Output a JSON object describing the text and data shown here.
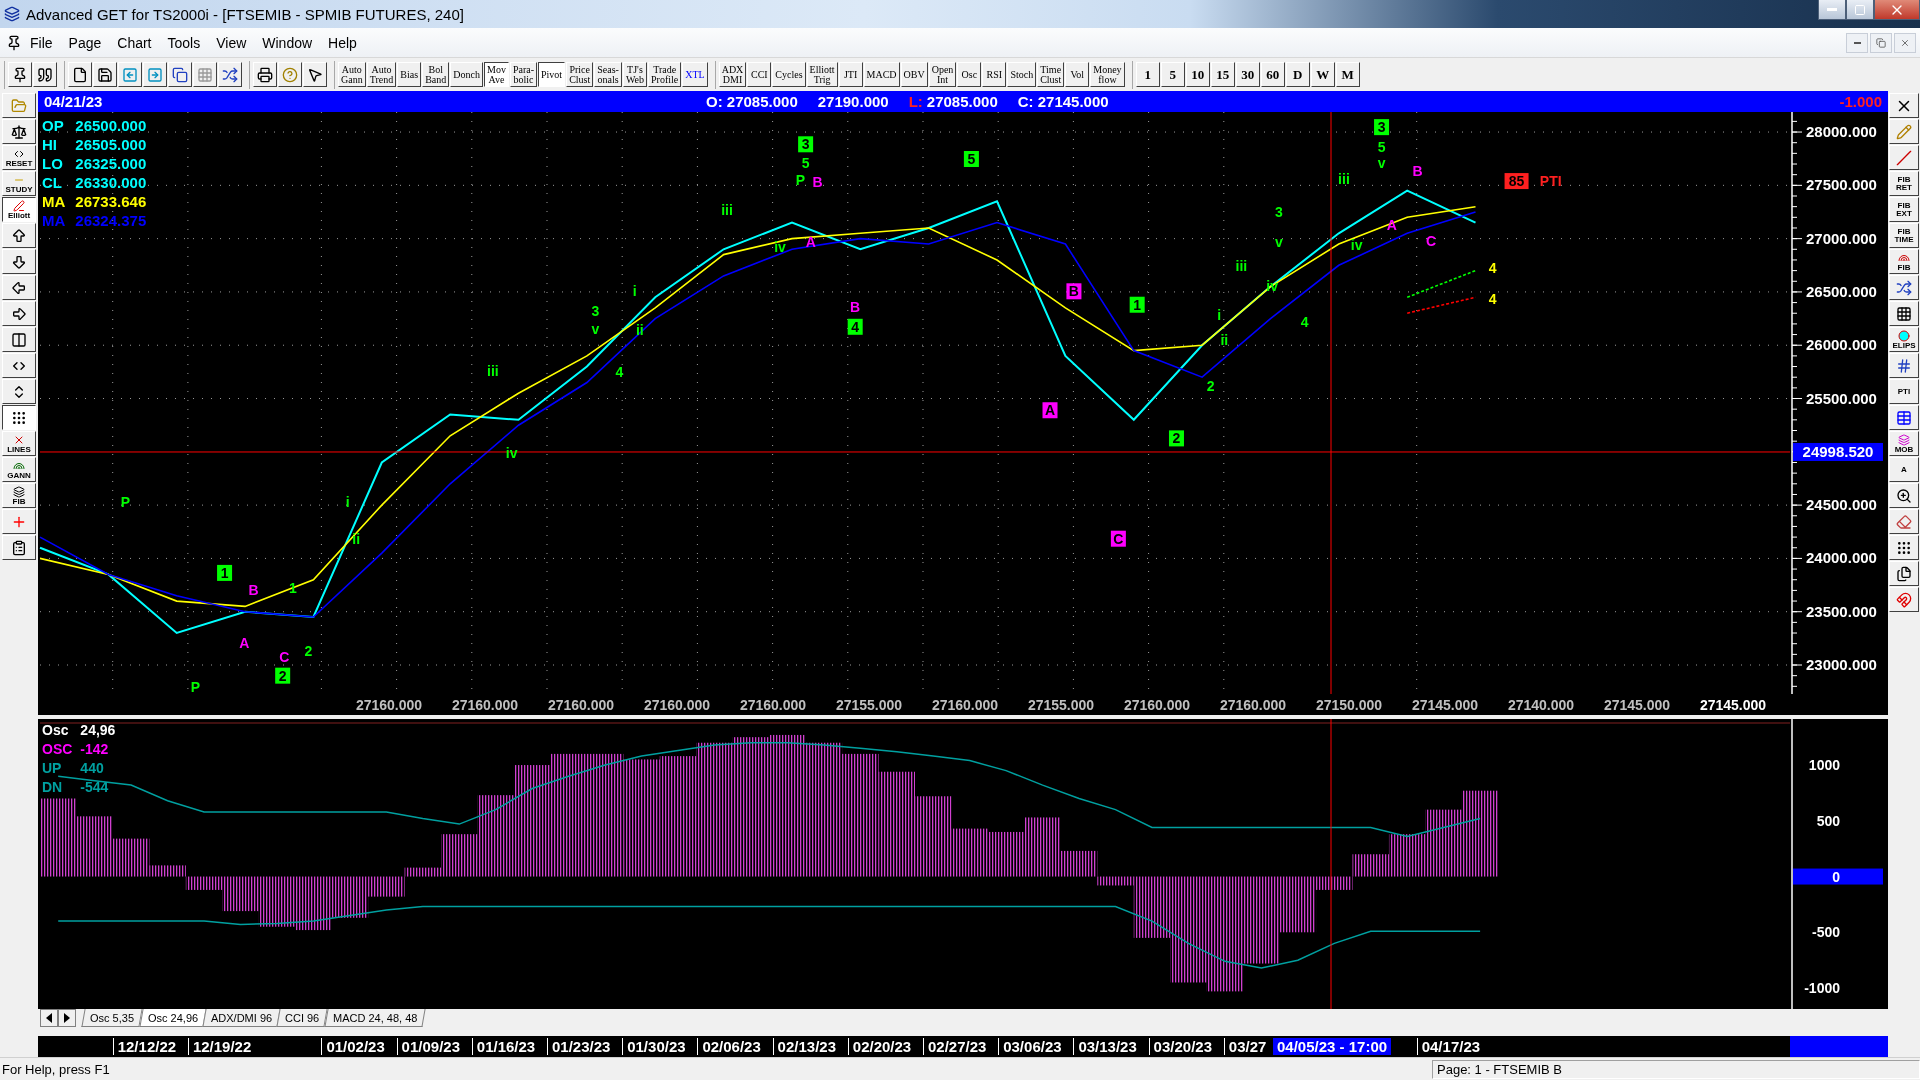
{
  "window": {
    "title": "Advanced GET for TS2000i - [FTSEMIB - SPMIB FUTURES, 240]"
  },
  "menu": [
    "File",
    "Page",
    "Chart",
    "Tools",
    "View",
    "Window",
    "Help"
  ],
  "toolbar": {
    "study_buttons": [
      {
        "label": "Auto\nGann",
        "pressed": false,
        "kind": "plain"
      },
      {
        "label": "Auto\nTrend",
        "pressed": false,
        "kind": "plain"
      },
      {
        "label": "Bias",
        "pressed": false,
        "kind": "plain"
      },
      {
        "label": "Bol\nBand",
        "pressed": false,
        "kind": "plain"
      },
      {
        "label": "Donch",
        "pressed": false,
        "kind": "plain"
      },
      {
        "label": "Mov\nAve",
        "pressed": true,
        "kind": "plain"
      },
      {
        "label": "Para-\nbolic",
        "pressed": false,
        "kind": "plain"
      },
      {
        "label": "Pivot",
        "pressed": true,
        "kind": "plain"
      },
      {
        "label": "Price\nClust",
        "pressed": false,
        "kind": "plain"
      },
      {
        "label": "Seas-\nonals",
        "pressed": false,
        "kind": "plain"
      },
      {
        "label": "TJ's\nWeb",
        "pressed": false,
        "kind": "plain"
      },
      {
        "label": "Trade\nProfile",
        "pressed": false,
        "kind": "plain"
      },
      {
        "label": "XTL",
        "pressed": false,
        "kind": "colored"
      }
    ],
    "indicator_buttons": [
      "ADX\nDMI",
      "CCI",
      "Cycles",
      "Elliott\nTrig",
      "JTI",
      "MACD",
      "OBV",
      "Open\nInt",
      "Osc",
      "RSI",
      "Stoch",
      "Time\nClust",
      "Vol",
      "Money\nflow"
    ],
    "interval_buttons": [
      "1",
      "5",
      "10",
      "15",
      "30",
      "60",
      "D",
      "W",
      "M"
    ]
  },
  "left_tools": [
    {
      "pressed": false
    },
    {
      "pressed": false
    },
    {
      "label": "RESET",
      "pressed": false
    },
    {
      "label": "STUDY",
      "pressed": false
    },
    {
      "label": "Elliott",
      "pressed": true
    },
    {
      "pressed": false
    },
    {
      "pressed": false
    },
    {
      "pressed": false
    },
    {
      "pressed": false
    },
    {
      "pressed": false
    },
    {
      "pressed": false
    },
    {
      "pressed": false
    },
    {
      "pressed": true
    },
    {
      "label": "LINES",
      "pressed": false
    },
    {
      "label": "GANN",
      "pressed": false
    },
    {
      "label": "FIB",
      "pressed": false
    },
    {
      "pressed": false
    },
    {
      "pressed": false
    }
  ],
  "right_tools": [
    "FIB\nRET",
    "FIB\nEXT",
    "FIB\nTIME",
    "FIB",
    "ELIPS",
    "PTI",
    "MOB",
    "A"
  ],
  "info_bar": {
    "date": "04/21/23",
    "open": "O: 27085.000",
    "high": "27190.000",
    "low_label": "L:",
    "low": "27085.000",
    "close": "C: 27145.000",
    "change": "-1.000"
  },
  "legend": [
    {
      "label": "OP",
      "value": "26500.000",
      "color": "#00ffff"
    },
    {
      "label": "HI",
      "value": "26505.000",
      "color": "#00ffff"
    },
    {
      "label": "LO",
      "value": "26325.000",
      "color": "#00ffff"
    },
    {
      "label": "CL",
      "value": "26330.000",
      "color": "#00ffff"
    },
    {
      "label": "MA",
      "value": "26733.646",
      "color": "#ffff00"
    },
    {
      "label": "MA",
      "value": "26324.375",
      "color": "#0000ff"
    }
  ],
  "price_chart": {
    "chart_data": {
      "type": "line",
      "grid": true,
      "categories": [
        null,
        null,
        null,
        null,
        null,
        null,
        null,
        null,
        null,
        null,
        null,
        null,
        null,
        null,
        null,
        null,
        null,
        null,
        null,
        null,
        null,
        null
      ],
      "ylim": [
        22728,
        28188
      ],
      "yticks": [
        {
          "value": 23000,
          "label": "23000.000"
        },
        {
          "value": 23500,
          "label": "23500.000"
        },
        {
          "value": 24000,
          "label": "24000.000"
        },
        {
          "value": 24500,
          "label": "24500.000"
        },
        {
          "value": 25500,
          "label": "25500.000"
        },
        {
          "value": 26000,
          "label": "26000.000"
        },
        {
          "value": 26500,
          "label": "26500.000"
        },
        {
          "value": 27000,
          "label": "27000.000"
        },
        {
          "value": 27500,
          "label": "27500.000"
        },
        {
          "value": 28000,
          "label": "28000.000"
        }
      ],
      "series": [
        {
          "color": "#00ffff",
          "values": [
            24100,
            23850,
            23300,
            23500,
            23450,
            24900,
            25350,
            25300,
            25800,
            26450,
            26900,
            27150,
            26900,
            27100,
            27350,
            25900,
            25300,
            26000,
            26550,
            27050,
            27450,
            27150
          ]
        },
        {
          "color": "#ffff00",
          "values": [
            24000,
            23850,
            23600,
            23550,
            23800,
            24500,
            25150,
            25550,
            25900,
            26350,
            26850,
            27000,
            27050,
            27100,
            26800,
            26350,
            25950,
            26000,
            26550,
            26950,
            27200,
            27300
          ]
        },
        {
          "color": "#0000ff",
          "values": [
            24200,
            23850,
            23650,
            23500,
            23450,
            24050,
            24700,
            25250,
            25650,
            26250,
            26650,
            26900,
            27000,
            26950,
            27150,
            26950,
            25950,
            25700,
            26250,
            26750,
            27050,
            27250
          ]
        },
        {
          "color": "#00ff00",
          "line_style": "dashed",
          "values": [
            null,
            null,
            null,
            null,
            null,
            null,
            null,
            null,
            null,
            null,
            null,
            null,
            null,
            null,
            null,
            null,
            null,
            null,
            null,
            null,
            26450,
            26700
          ]
        },
        {
          "color": "#ff0000",
          "line_style": "dashed",
          "values": [
            null,
            null,
            null,
            null,
            null,
            null,
            null,
            null,
            null,
            null,
            null,
            null,
            null,
            null,
            null,
            null,
            null,
            null,
            null,
            null,
            26300,
            26450
          ]
        }
      ],
      "ref_lines": [
        {
          "axis": "y",
          "value": 24998.52,
          "label": "24998.520"
        }
      ],
      "annotations": [
        "P",
        "P",
        "1",
        "B",
        "A",
        "C",
        "2",
        "1",
        "2",
        "i",
        "ii",
        "iii",
        "iv",
        "3",
        "v",
        "4",
        "i",
        "ii",
        "iii",
        "3",
        "5",
        "P",
        "B",
        "iv",
        "A",
        "5",
        "B",
        "4",
        "B",
        "A",
        "C",
        "1",
        "2",
        "2",
        "i",
        "ii",
        "iii",
        "3",
        "v",
        "iv",
        "4",
        "iii",
        "iv",
        "3",
        "5",
        "v",
        "A",
        "B",
        "C",
        "4",
        "4",
        "85",
        "PTI"
      ]
    },
    "wave_styles": [
      {
        "color": "#00ff00",
        "boxed": false
      },
      {
        "color": "#00ff00",
        "boxed": false
      },
      {
        "color": "#00ff00",
        "boxed": true
      },
      {
        "color": "#ff00ff",
        "boxed": false
      },
      {
        "color": "#ff00ff",
        "boxed": false
      },
      {
        "color": "#ff00ff",
        "boxed": false
      },
      {
        "color": "#00ff00",
        "boxed": true
      },
      {
        "color": "#00ff00",
        "boxed": false
      },
      {
        "color": "#00ff00",
        "boxed": false
      },
      {
        "color": "#00ff00",
        "boxed": false
      },
      {
        "color": "#00ff00",
        "boxed": false
      },
      {
        "color": "#00ff00",
        "boxed": false
      },
      {
        "color": "#00ff00",
        "boxed": false
      },
      {
        "color": "#00ff00",
        "boxed": false
      },
      {
        "color": "#00ff00",
        "boxed": false
      },
      {
        "color": "#00ff00",
        "boxed": false
      },
      {
        "color": "#00ff00",
        "boxed": false
      },
      {
        "color": "#00ff00",
        "boxed": false
      },
      {
        "color": "#00ff00",
        "boxed": false
      },
      {
        "color": "#00ff00",
        "boxed": true
      },
      {
        "color": "#00ff00",
        "boxed": false
      },
      {
        "color": "#00ff00",
        "boxed": false
      },
      {
        "color": "#ff00ff",
        "boxed": false
      },
      {
        "color": "#00ff00",
        "boxed": false
      },
      {
        "color": "#ff00ff",
        "boxed": false
      },
      {
        "color": "#00ff00",
        "boxed": true
      },
      {
        "color": "#ff00ff",
        "boxed": false
      },
      {
        "color": "#00ff00",
        "boxed": true
      },
      {
        "color": "#ff00ff",
        "boxed": true
      },
      {
        "color": "#ff00ff",
        "boxed": true
      },
      {
        "color": "#ff00ff",
        "boxed": true
      },
      {
        "color": "#00ff00",
        "boxed": true
      },
      {
        "color": "#00ff00",
        "boxed": true
      },
      {
        "color": "#00ff00",
        "boxed": false
      },
      {
        "color": "#00ff00",
        "boxed": false
      },
      {
        "color": "#00ff00",
        "boxed": false
      },
      {
        "color": "#00ff00",
        "boxed": false
      },
      {
        "color": "#00ff00",
        "boxed": false
      },
      {
        "color": "#00ff00",
        "boxed": false
      },
      {
        "color": "#00ff00",
        "boxed": false
      },
      {
        "color": "#00ff00",
        "boxed": false
      },
      {
        "color": "#00ff00",
        "boxed": false
      },
      {
        "color": "#00ff00",
        "boxed": false
      },
      {
        "color": "#00ff00",
        "boxed": true
      },
      {
        "color": "#00ff00",
        "boxed": false
      },
      {
        "color": "#00ff00",
        "boxed": false
      },
      {
        "color": "#ff00ff",
        "boxed": false
      },
      {
        "color": "#ff00ff",
        "boxed": false
      },
      {
        "color": "#ff00ff",
        "boxed": false
      },
      {
        "color": "#ffff00",
        "boxed": false
      },
      {
        "color": "#ffff00",
        "boxed": false
      },
      {
        "color": "#ff2020",
        "boxed": true
      },
      {
        "color": "#ff2020",
        "boxed": false
      }
    ],
    "x_readouts": [
      {
        "text": "27160.000",
        "current": false
      },
      {
        "text": "27160.000",
        "current": false
      },
      {
        "text": "27160.000",
        "current": false
      },
      {
        "text": "27160.000",
        "current": false
      },
      {
        "text": "27160.000",
        "current": false
      },
      {
        "text": "27155.000",
        "current": false
      },
      {
        "text": "27160.000",
        "current": false
      },
      {
        "text": "27155.000",
        "current": false
      },
      {
        "text": "27160.000",
        "current": false
      },
      {
        "text": "27160.000",
        "current": false
      },
      {
        "text": "27150.000",
        "current": false
      },
      {
        "text": "27145.000",
        "current": false
      },
      {
        "text": "27140.000",
        "current": false
      },
      {
        "text": "27145.000",
        "current": false
      },
      {
        "text": "27145.000",
        "current": true
      }
    ],
    "cursor_date": "04/05/23 - 17:00"
  },
  "oscillator": {
    "legend": [
      {
        "label": "Osc",
        "value": "24,96",
        "color": "#ffffff"
      },
      {
        "label": "OSC",
        "value": "-142",
        "color": "#ff00ff"
      },
      {
        "label": "UP",
        "value": "440",
        "color": "#00a0a0"
      },
      {
        "label": "DN",
        "value": "-544",
        "color": "#00a0a0"
      }
    ],
    "chart_data": {
      "type": "bar",
      "ref_lines": [
        {
          "axis": "y",
          "value": 1377
        }
      ],
      "categories": [
        null,
        null,
        null,
        null,
        null,
        null,
        null,
        null,
        null,
        null,
        null,
        null,
        null,
        null,
        null,
        null,
        null,
        null,
        null,
        null,
        null,
        null,
        null,
        null,
        null,
        null,
        null,
        null,
        null,
        null,
        null,
        null,
        null,
        null,
        null,
        null,
        null,
        null,
        null,
        null,
        null,
        null,
        null,
        null,
        null,
        null,
        null,
        null
      ],
      "ylim": [
        -1188,
        1413
      ],
      "yticks": [
        {
          "value": 1000,
          "label": "1000"
        },
        {
          "value": 500,
          "label": "500"
        },
        {
          "value": 0,
          "label": "0"
        },
        {
          "value": -500,
          "label": "-500"
        },
        {
          "value": -1000,
          "label": "-1000"
        }
      ],
      "series": [
        {
          "color": "#d040d0",
          "values": [
            700,
            540,
            340,
            100,
            -120,
            -310,
            -450,
            -480,
            -370,
            -180,
            80,
            380,
            730,
            1000,
            1100,
            1100,
            1050,
            1080,
            1200,
            1250,
            1270,
            1200,
            1100,
            940,
            720,
            430,
            400,
            530,
            230,
            -80,
            -550,
            -950,
            -1030,
            -780,
            -500,
            -120,
            200,
            380,
            600,
            770,
            null,
            null,
            null,
            null,
            null,
            null,
            null,
            null
          ]
        },
        {
          "type": "line",
          "color": "#00a0a0",
          "values": [
            900,
            860,
            820,
            680,
            580,
            580,
            580,
            580,
            580,
            580,
            520,
            470,
            600,
            790,
            900,
            1000,
            1080,
            1130,
            1180,
            1200,
            1200,
            1180,
            1150,
            1120,
            1080,
            1040,
            950,
            820,
            700,
            600,
            440,
            440,
            440,
            440,
            440,
            440,
            440,
            360,
            440,
            520,
            null,
            null,
            null,
            null,
            null,
            null,
            null,
            null
          ]
        },
        {
          "type": "line",
          "color": "#00a0a0",
          "values": [
            -400,
            -400,
            -400,
            -400,
            -400,
            -430,
            -420,
            -400,
            -350,
            -300,
            -270,
            -270,
            -270,
            -270,
            -270,
            -270,
            -270,
            -270,
            -270,
            -270,
            -270,
            -270,
            -270,
            -270,
            -270,
            -270,
            -270,
            -270,
            -270,
            -270,
            -400,
            -600,
            -760,
            -820,
            -750,
            -600,
            -490,
            -490,
            -490,
            -490,
            null,
            null,
            null,
            null,
            null,
            null,
            null,
            null
          ]
        }
      ]
    }
  },
  "date_axis": [
    "12/12/22",
    "12/19/22",
    "01/02/23",
    "01/09/23",
    "01/16/23",
    "01/23/23",
    "01/30/23",
    "02/06/23",
    "02/13/23",
    "02/20/23",
    "02/27/23",
    "03/06/23",
    "03/13/23",
    "03/20/23",
    "03/27",
    "04/17/23"
  ],
  "tabs": [
    {
      "label": "Osc 5,35",
      "selected": false
    },
    {
      "label": "Osc 24,96",
      "selected": true
    },
    {
      "label": "ADX/DMI 96",
      "selected": false
    },
    {
      "label": "CCI 96",
      "selected": false
    },
    {
      "label": "MACD 24, 48, 48",
      "selected": false
    }
  ],
  "status_bar": {
    "help": "For Help, press F1",
    "page": "Page: 1 - FTSEMIB B"
  }
}
